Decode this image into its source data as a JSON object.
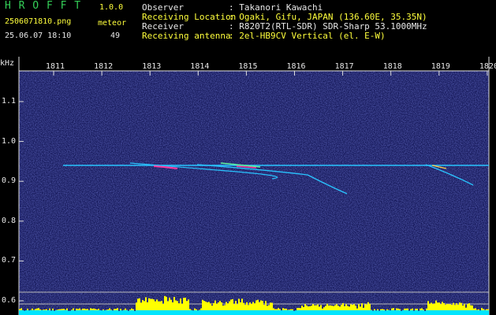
{
  "app": {
    "name": "H R O F F T",
    "version": "1.0.0",
    "filename": "2506071810.png",
    "datetime": "25.06.07 18:10",
    "meteor_label": "meteor",
    "meteor_count": "49"
  },
  "info": {
    "observer_label": "Observer",
    "observer_value": ": Takanori Kawachi",
    "location_label": "Receiving Location",
    "location_value": ": Ogaki, Gifu, JAPAN (136.60E, 35.35N)",
    "receiver_label": "Receiver",
    "receiver_value": ": R820T2(RTL-SDR) SDR-Sharp 53.1000MHz",
    "antenna_label": "Receiving antenna",
    "antenna_value": ": 2el-HB9CV Vertical (el. E-W)"
  },
  "axes": {
    "y_unit": "kHz",
    "x_ticks": [
      "1811",
      "1812",
      "1813",
      "1814",
      "1815",
      "1816",
      "1817",
      "1818",
      "1819",
      "1820"
    ],
    "y_ticks": [
      "1.1",
      "1.0",
      "0.9",
      "0.8",
      "0.7",
      "0.6"
    ]
  },
  "colors": {
    "background": "#000000",
    "noise_bg": "#1c1f5e",
    "signal": "#29c4ff",
    "meteor_peak": "#ff3ca0",
    "power_high": "#ffff00",
    "power_low": "#00e5ff",
    "header_title": "#34d058",
    "header_text": "#e8e8e8",
    "header_yellow": "#ffff3c"
  }
}
